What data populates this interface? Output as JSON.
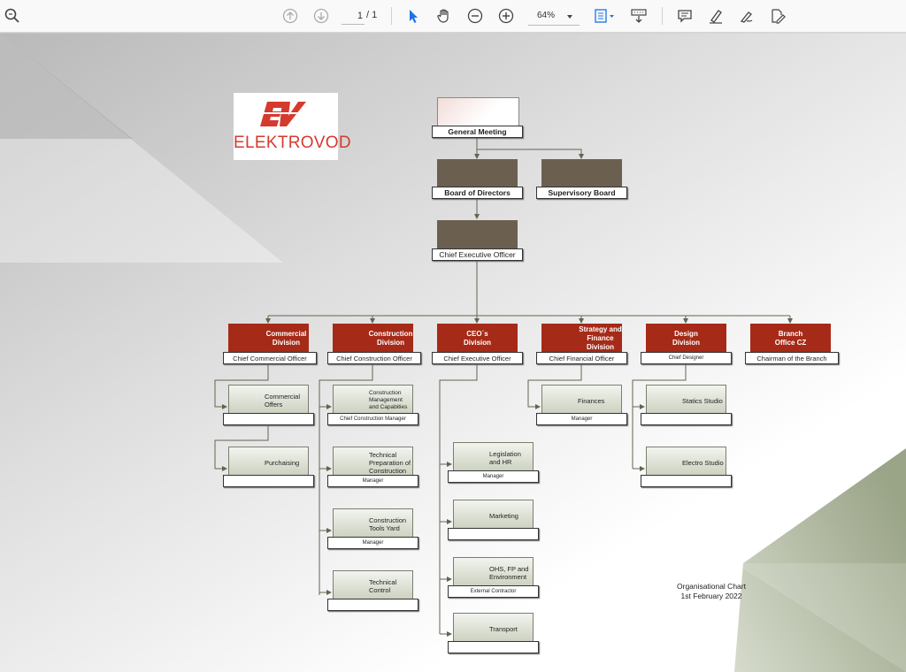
{
  "toolbar": {
    "page_current": "1",
    "page_total": "/ 1",
    "zoom": "64%",
    "icons": [
      "search-icon",
      "page-up-icon",
      "page-down-icon",
      "select-cursor-icon",
      "hand-pan-icon",
      "zoom-out-icon",
      "zoom-in-icon",
      "fit-page-icon",
      "scroll-mode-icon",
      "comment-icon",
      "highlight-pen-icon",
      "draw-icon",
      "edit-text-icon"
    ]
  },
  "logo": {
    "monogram": "EV",
    "text": "ELEKTROVOD",
    "color": "#d53a2f"
  },
  "chart": {
    "general_meeting": "General Meeting",
    "board": "Board of Directors",
    "supervisory": "Supervisory Board",
    "ceo": "Chief Executive Officer",
    "divisions": [
      {
        "name": "Commercial\nDivision",
        "head": "Chief Commercial Officer"
      },
      {
        "name": "Construction\nDivision",
        "head": "Chief Construction Officer"
      },
      {
        "name": "CEO´s\nDivision",
        "head": "Chief Executive Officer"
      },
      {
        "name": "Strategy and\nFinance\nDivision",
        "head": "Chief Financial Officer"
      },
      {
        "name": "Design\nDivision",
        "head": "Chief Designer"
      },
      {
        "name": "Branch\nOffice CZ",
        "head": "Chairman of the Branch"
      }
    ],
    "commercial": [
      {
        "name": "Commercial\nOffers",
        "role": ""
      },
      {
        "name": "Purchaising",
        "role": ""
      }
    ],
    "construction": [
      {
        "name": "Construction\nManagement\nand Capabities",
        "role": "Chief Construction Manager"
      },
      {
        "name": "Technical\nPreparation of\nConstruction",
        "role": "Manager"
      },
      {
        "name": "Construction\nTools Yard",
        "role": "Manager"
      },
      {
        "name": "Technical\nControl",
        "role": ""
      }
    ],
    "ceo_units": [
      {
        "name": "Legislation\nand HR",
        "role": "Manager"
      },
      {
        "name": "Marketing",
        "role": ""
      },
      {
        "name": "OHS, FP and\nEnvironment",
        "role": "External Contractor"
      },
      {
        "name": "Transport",
        "role": ""
      }
    ],
    "finance": [
      {
        "name": "Finances",
        "role": "Manager"
      }
    ],
    "design": [
      {
        "name": "Statics Studio",
        "role": ""
      },
      {
        "name": "Electro Studio",
        "role": ""
      }
    ],
    "caption_line1": "Organisational Chart",
    "caption_line2": "1st February 2022"
  },
  "colors": {
    "division_red": "#a62a18",
    "board_brown": "#6b6050",
    "connector": "#5f6650",
    "accent_blue": "#1a73e8"
  }
}
